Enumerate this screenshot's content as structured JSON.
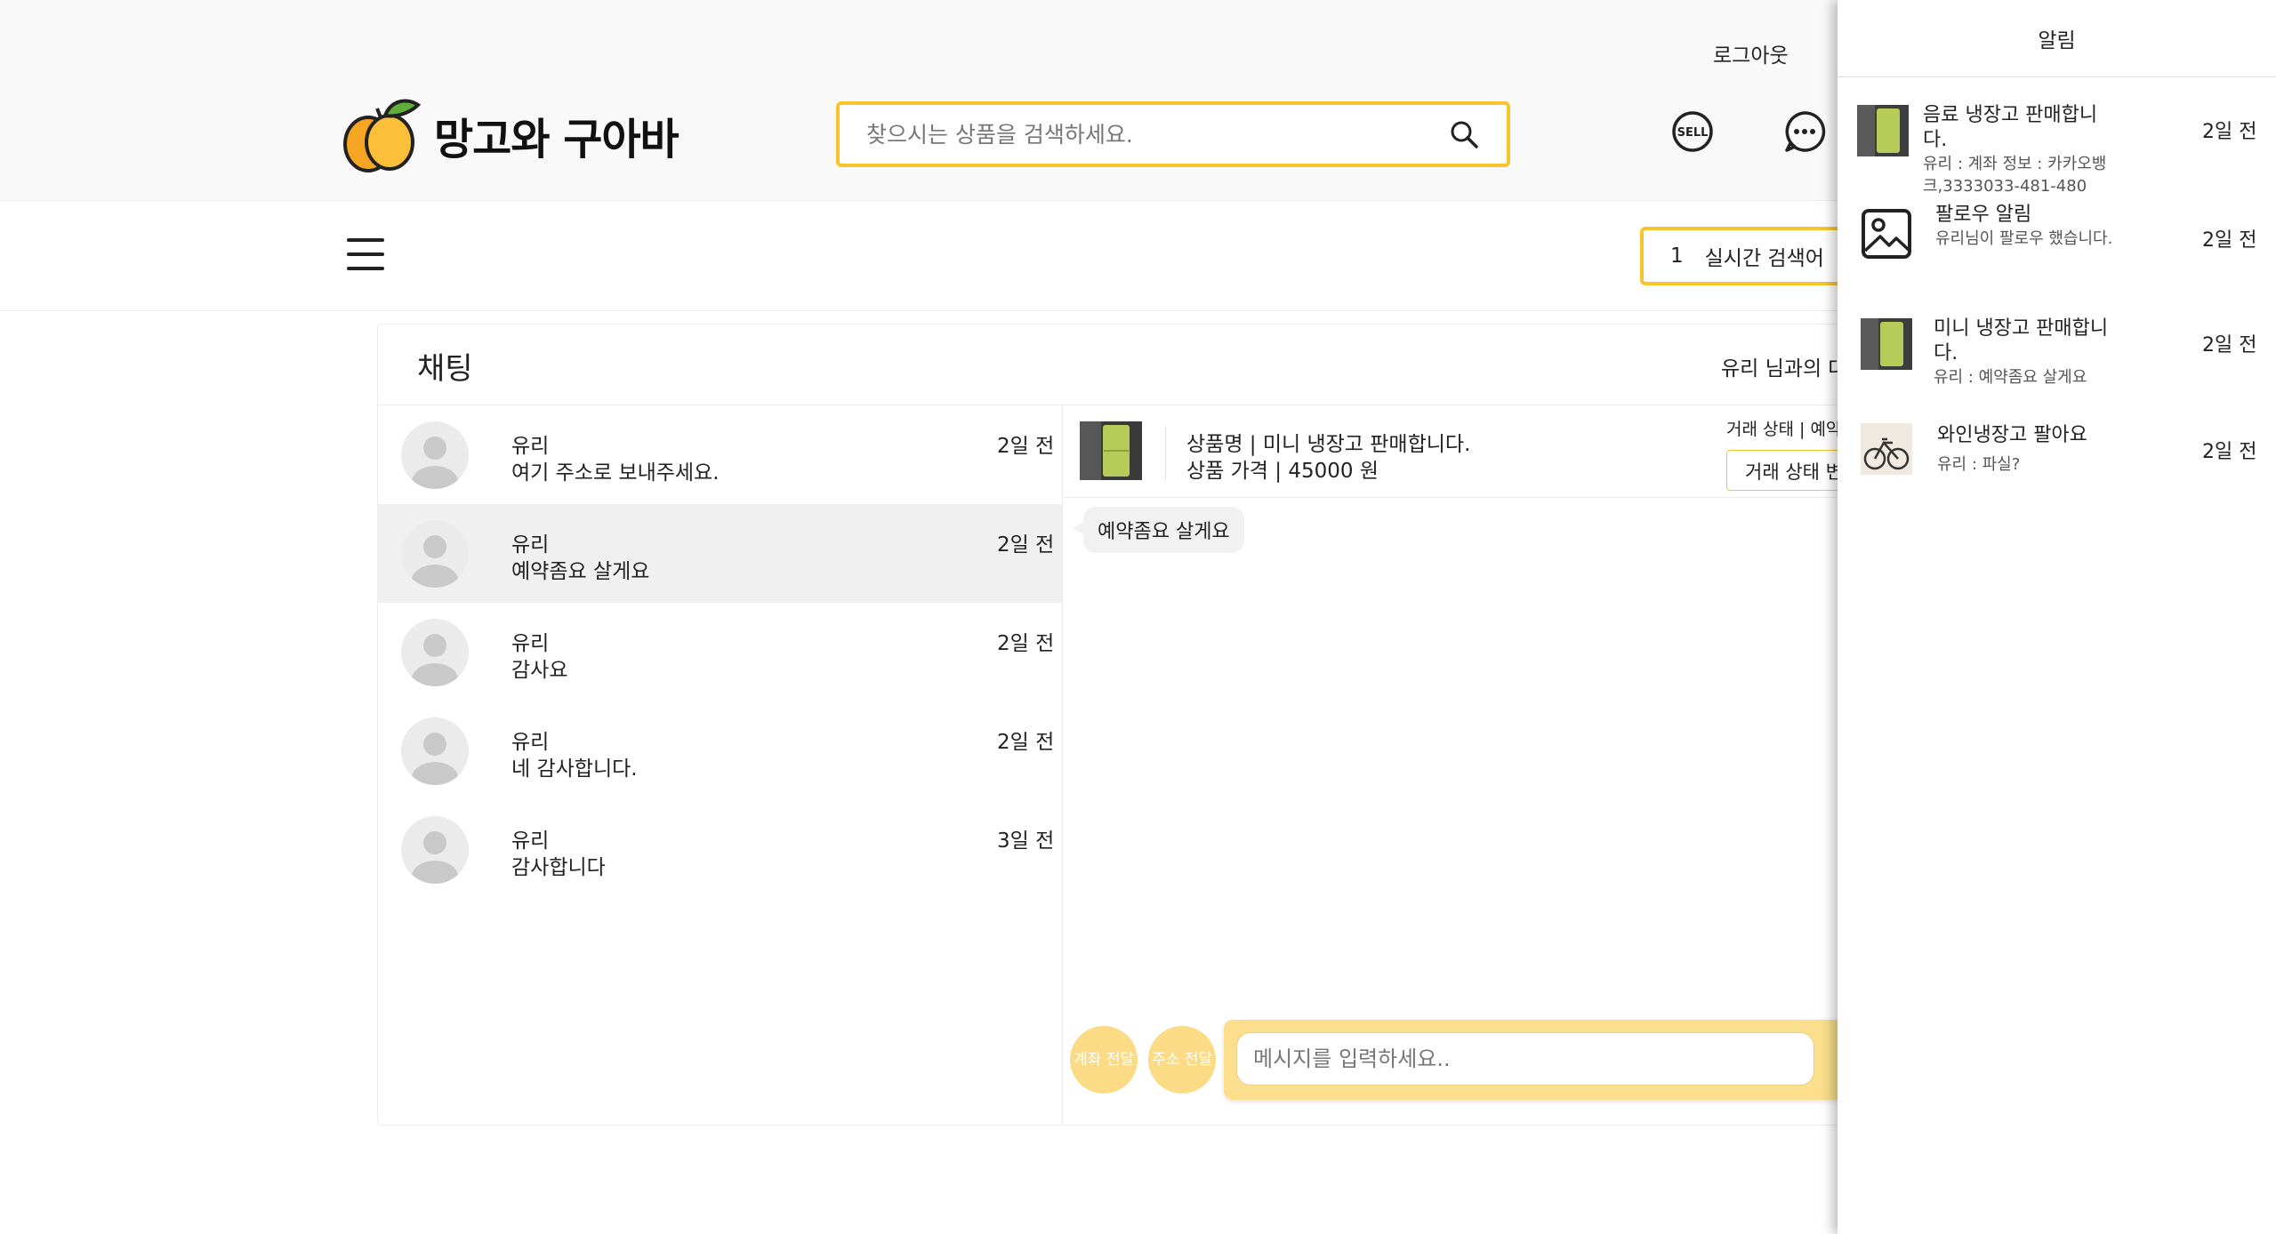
{
  "header": {
    "logout": "로그아웃",
    "logo_text": "망고와 구아바",
    "search_placeholder": "찾으시는 상품을 검색하세요.",
    "sell_icon_text": "SELL",
    "realtime_rank": "1",
    "realtime_label": "실시간 검색어"
  },
  "chat": {
    "title": "채팅",
    "partner_label": "유리 님과의 대",
    "rooms": [
      {
        "name": "유리",
        "message": "여기 주소로 보내주세요.",
        "time": "2일 전"
      },
      {
        "name": "유리",
        "message": "예약좀요 살게요",
        "time": "2일 전"
      },
      {
        "name": "유리",
        "message": "감사요",
        "time": "2일 전"
      },
      {
        "name": "유리",
        "message": "네 감사합니다.",
        "time": "2일 전"
      },
      {
        "name": "유리",
        "message": "감사합니다",
        "time": "3일 전"
      }
    ],
    "product": {
      "name": "상품명 | 미니 냉장고 판매합니다.",
      "price": "상품 가격 | 45000 원",
      "trade_status_label": "거래 상태 | 예약",
      "trade_status_select": "거래 상태 변"
    },
    "messages": [
      {
        "text": "예약좀요 살게요"
      }
    ],
    "quick_account": "계좌 전달",
    "quick_address": "주소 전달",
    "input_placeholder": "메시지를 입력하세요.."
  },
  "notifications": {
    "title": "알림",
    "items": [
      {
        "title": "음료 냉장고 판매합니다.",
        "body": "유리 : 계좌 정보 : 카카오뱅크,3333033-481-480",
        "time": "2일 전",
        "thumb": "fridge"
      },
      {
        "title": "팔로우 알림",
        "body": "유리님이 팔로우 했습니다.",
        "time": "2일 전",
        "thumb": "image-placeholder-icon"
      },
      {
        "title": "미니 냉장고 판매합니다.",
        "body": "유리 : 예약좀요 살게요",
        "time": "2일 전",
        "thumb": "fridge"
      },
      {
        "title": "와인냉장고 팔아요",
        "body": "유리 : 파실?",
        "time": "2일 전",
        "thumb": "bicycle"
      }
    ]
  },
  "colors": {
    "accent": "#f7c52b",
    "input_bg": "#fbdf8c",
    "quick_btn": "#fbdb86"
  }
}
